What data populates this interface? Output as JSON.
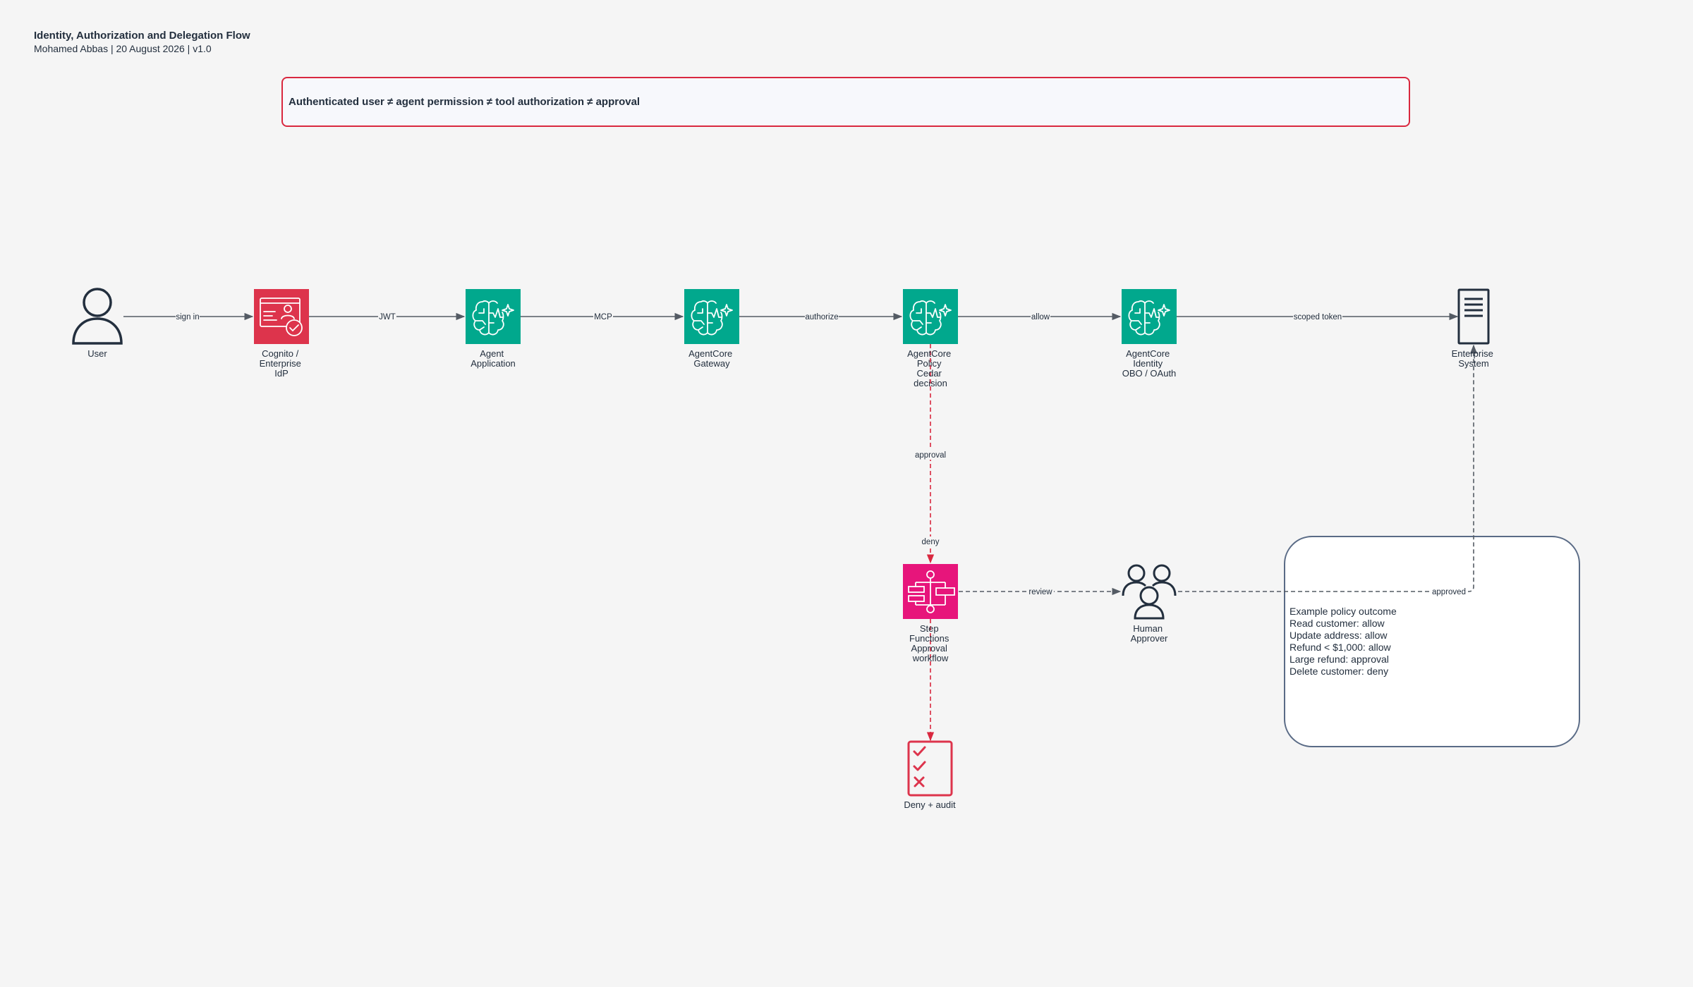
{
  "header": {
    "title": "Identity, Authorization and Delegation Flow",
    "subtitle": "Mohamed Abbas | 20 August 2026 | v1.0"
  },
  "banner": {
    "text": "Authenticated user ≠ agent permission ≠ tool authorization ≠ approval",
    "border_color": "#d9283f"
  },
  "colors": {
    "teal": "#01a88d",
    "red": "#dd344c",
    "pink": "#e7157b",
    "dark": "#232f3e",
    "deny_line": "#d9283f",
    "edge": "#545b64"
  },
  "nodes": {
    "user": {
      "icon": "user-icon",
      "lines": [
        "User"
      ]
    },
    "cognito": {
      "icon": "identity-card-icon",
      "lines": [
        "Cognito /",
        "Enterprise",
        "IdP"
      ]
    },
    "agent_app": {
      "icon": "agent-brain-icon",
      "lines": [
        "Agent",
        "Application"
      ]
    },
    "gateway": {
      "icon": "agent-brain-icon",
      "lines": [
        "AgentCore",
        "Gateway"
      ]
    },
    "policy": {
      "icon": "agent-brain-icon",
      "lines": [
        "AgentCore",
        "Policy",
        "Cedar",
        "decision"
      ]
    },
    "identity": {
      "icon": "agent-brain-icon",
      "lines": [
        "AgentCore",
        "Identity",
        "OBO / OAuth"
      ]
    },
    "enterprise": {
      "icon": "server-document-icon",
      "lines": [
        "Enterprise",
        "System"
      ]
    },
    "step_functions": {
      "icon": "step-functions-icon",
      "lines": [
        "Step",
        "Functions",
        "Approval",
        "workflow"
      ]
    },
    "human": {
      "icon": "users-group-icon",
      "lines": [
        "Human",
        "Approver"
      ]
    },
    "deny": {
      "icon": "checklist-icon",
      "lines": [
        "Deny + audit"
      ]
    }
  },
  "edges": {
    "sign_in": "sign in",
    "jwt": "JWT",
    "mcp": "MCP",
    "authorize": "authorize",
    "allow": "allow",
    "scoped_token": "scoped token",
    "approval": "approval",
    "deny": "deny",
    "review": "review",
    "approved": "approved"
  },
  "policy_outcome": {
    "title": "Example policy outcome",
    "lines": [
      "Read customer: allow",
      "Update address: allow",
      "Refund < $1,000: allow",
      "Large refund: approval",
      "Delete customer: deny"
    ]
  }
}
